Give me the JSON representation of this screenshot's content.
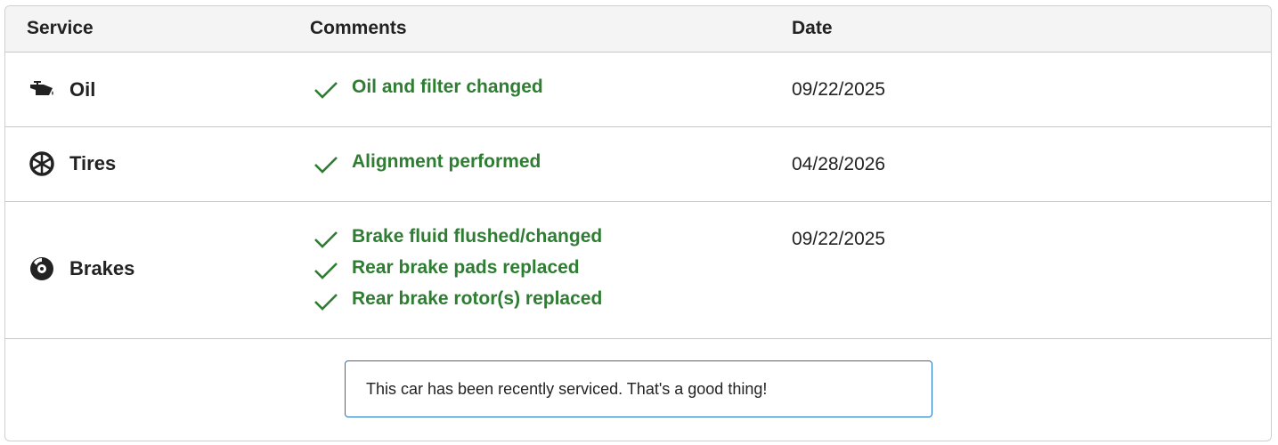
{
  "table": {
    "headers": {
      "service": "Service",
      "comments": "Comments",
      "date": "Date"
    },
    "rows": [
      {
        "icon": "oil-can-icon",
        "service": "Oil",
        "comments": [
          "Oil and filter changed"
        ],
        "date": "09/22/2025"
      },
      {
        "icon": "tire-icon",
        "service": "Tires",
        "comments": [
          "Alignment performed"
        ],
        "date": "04/28/2026"
      },
      {
        "icon": "brake-disc-icon",
        "service": "Brakes",
        "comments": [
          "Brake fluid flushed/changed",
          "Rear brake pads replaced",
          "Rear brake rotor(s) replaced"
        ],
        "date": "09/22/2025"
      }
    ]
  },
  "notice": {
    "text": "This car has been recently serviced. That's a good thing!"
  },
  "colors": {
    "comment_green": "#2e7d32",
    "notice_border": "#1e6fc7",
    "header_bg": "#f4f4f4"
  }
}
